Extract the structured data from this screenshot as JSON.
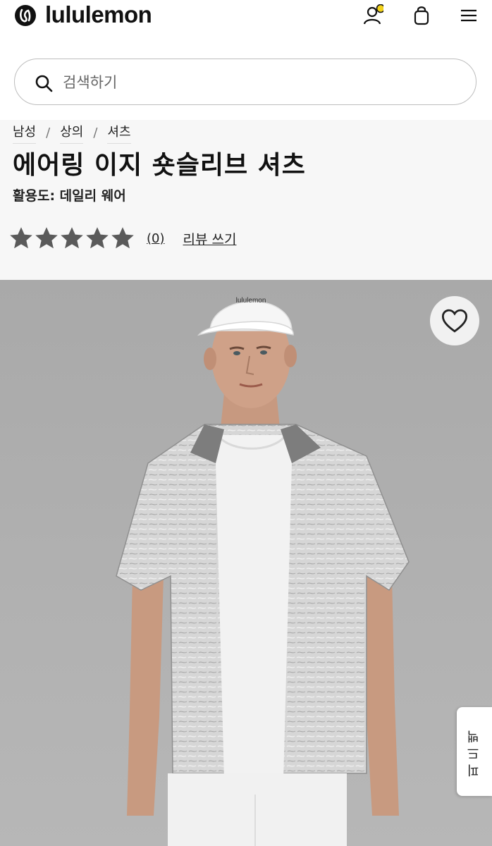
{
  "brand": {
    "name": "lululemon"
  },
  "header": {
    "icons": [
      "account-icon",
      "shopping-bag-icon",
      "menu-icon"
    ],
    "notification_dot_color": "#f2d21b"
  },
  "search": {
    "placeholder": "검색하기"
  },
  "breadcrumb": {
    "items": [
      "남성",
      "상의",
      "셔츠"
    ],
    "separator": "/"
  },
  "product": {
    "title": "에어링 이지 숏슬리브 셔츠",
    "activity": "활용도: 데일리 웨어",
    "rating": {
      "stars": 5,
      "filled": 5,
      "count_label": "(0)",
      "review_label": "리뷰 쓰기"
    }
  },
  "hero_image": {
    "description_icons": [
      "wishlist-heart-icon"
    ],
    "background_color": "#aeaeae"
  },
  "side_tab": {
    "label": "피드백"
  }
}
